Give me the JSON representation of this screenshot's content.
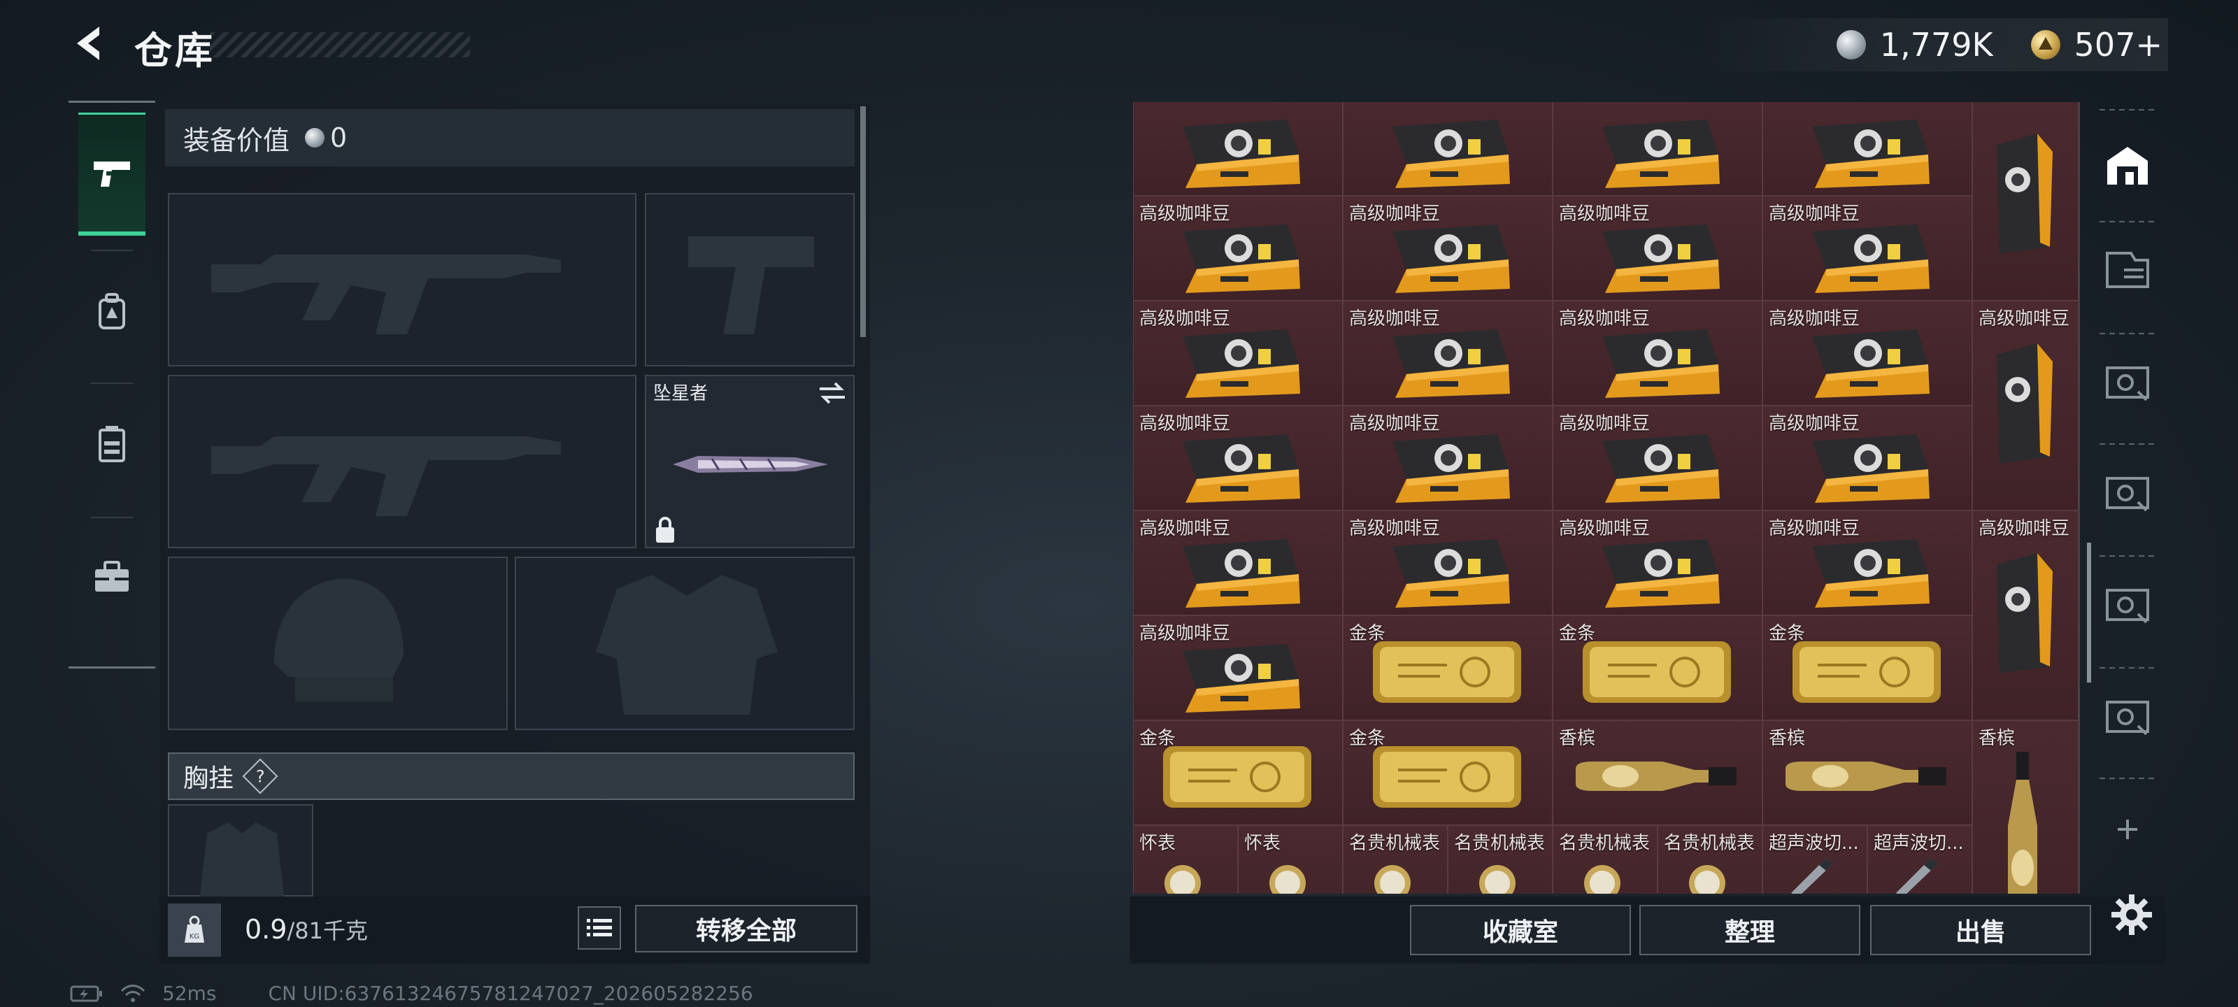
{
  "header": {
    "title": "仓库",
    "currency": {
      "silver": "1,779K",
      "gold": "507+"
    }
  },
  "left_rail": {
    "items": [
      {
        "name": "weapons",
        "icon": "pistol-icon"
      },
      {
        "name": "backpack",
        "icon": "backpack-icon"
      },
      {
        "name": "vest",
        "icon": "chest-rig-icon"
      },
      {
        "name": "supplies",
        "icon": "toolbox-icon"
      }
    ]
  },
  "equipment": {
    "value_label": "装备价值",
    "value": "0",
    "melee_label": "坠星者",
    "chest_label": "胸挂",
    "chest_help": "?",
    "weight_current": "0.9",
    "weight_max": "/81千克",
    "transfer_all": "转移全部"
  },
  "storage": {
    "rows": [
      [
        "高级咖啡豆",
        "高级咖啡豆",
        "高级咖啡豆",
        "高级咖啡豆"
      ],
      [
        "高级咖啡豆",
        "高级咖啡豆",
        "高级咖啡豆",
        "高级咖啡豆"
      ],
      [
        "高级咖啡豆",
        "高级咖啡豆",
        "高级咖啡豆",
        "高级咖啡豆"
      ],
      [
        "高级咖啡豆",
        "高级咖啡豆",
        "高级咖啡豆",
        "高级咖啡豆"
      ],
      [
        "高级咖啡豆",
        "高级咖啡豆",
        "高级咖啡豆",
        "高级咖啡豆"
      ],
      [
        "高级咖啡豆",
        "金条",
        "金条",
        "金条"
      ],
      [
        "金条",
        "金条",
        "香槟",
        "香槟"
      ]
    ],
    "right_column": [
      "高级咖啡豆",
      "高级咖啡豆",
      "高级咖啡豆",
      "香槟"
    ],
    "small_row": [
      "怀表",
      "怀表",
      "名贵机械表",
      "名贵机械表",
      "名贵机械表",
      "名贵机械表",
      "超声波切...",
      "超声波切..."
    ]
  },
  "actions": {
    "collection": "收藏室",
    "sort": "整理",
    "sell": "出售"
  },
  "status_bar": {
    "ping": "52ms",
    "uid": "CN UID:63761324675781247027_202605282256"
  }
}
